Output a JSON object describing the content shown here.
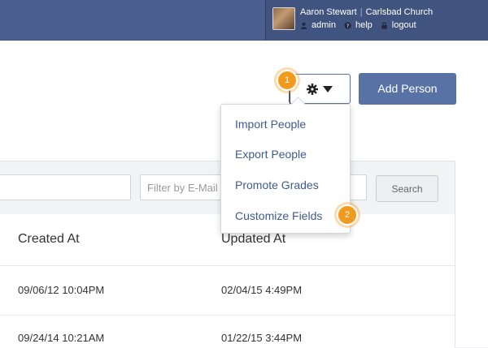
{
  "user": {
    "name": "Aaron Stewart",
    "separator": "|",
    "church": "Carlsbad Church",
    "links": {
      "admin": "admin",
      "help": "help",
      "logout": "logout"
    }
  },
  "toolbar": {
    "add_person_label": "Add Person"
  },
  "dropdown": {
    "items": [
      "Import People",
      "Export People",
      "Promote Grades",
      "Customize Fields"
    ]
  },
  "filters": {
    "email_placeholder": "Filter by E-Mail",
    "search_label": "Search"
  },
  "table": {
    "columns": [
      "Created At",
      "Updated At"
    ],
    "rows": [
      [
        "09/06/12 10:04PM",
        "02/04/15 4:49PM"
      ],
      [
        "09/24/14 10:21AM",
        "01/22/15 3:44PM"
      ]
    ]
  },
  "steps": [
    "1",
    "2"
  ],
  "colors": {
    "topbar": "#4a5f8f",
    "accent": "#5872a6",
    "link": "#3f5a92",
    "badge": "#f29a1d"
  },
  "icons": [
    "user-icon",
    "help-icon",
    "lock-icon",
    "gear-icon",
    "caret-down-icon"
  ]
}
